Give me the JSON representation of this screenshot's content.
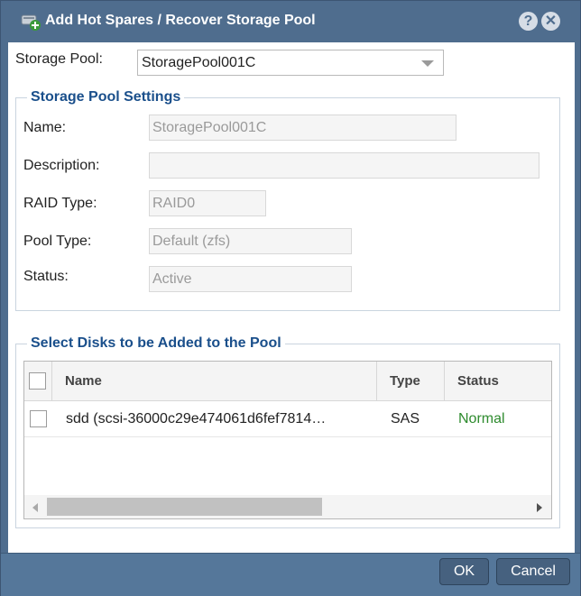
{
  "window": {
    "title": "Add Hot Spares / Recover Storage Pool",
    "help_icon": "help-icon",
    "close_icon": "close-icon",
    "title_icon": "storage-pool-add-icon"
  },
  "storage_pool": {
    "label": "Storage Pool:",
    "selected": "StoragePool001C"
  },
  "settings": {
    "legend": "Storage Pool Settings",
    "name_label": "Name:",
    "name_value": "StoragePool001C",
    "description_label": "Description:",
    "description_value": "",
    "raid_label": "RAID Type:",
    "raid_value": "RAID0",
    "pool_type_label": "Pool Type:",
    "pool_type_value": "Default (zfs)",
    "status_label": "Status:",
    "status_value": "Active"
  },
  "disks": {
    "legend": "Select Disks to be Added to the Pool",
    "columns": [
      "Name",
      "Type",
      "Status"
    ],
    "rows": [
      {
        "name": "sdd (scsi-36000c29e474061d6fef7814…",
        "type": "SAS",
        "status": "Normal",
        "checked": false
      }
    ]
  },
  "footer": {
    "ok_label": "OK",
    "cancel_label": "Cancel"
  },
  "colors": {
    "title_bar": "#4f6d8e",
    "accent_text": "#1a4f8b",
    "status_normal": "#2e8b2e"
  }
}
